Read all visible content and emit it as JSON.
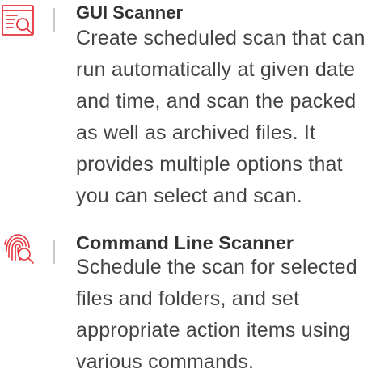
{
  "colors": {
    "accent": "#e4343b",
    "title": "#333333",
    "body": "#444444",
    "divider": "#c9c9c9"
  },
  "features": [
    {
      "icon": "window-search-icon",
      "title": "GUI Scanner",
      "description": "Create scheduled scan that can run automatically at given date and time, and scan the packed as well as archived files. It provides multiple options that you can select and scan."
    },
    {
      "icon": "fingerprint-scan-icon",
      "title": "Command Line Scanner",
      "description": "Schedule the scan for selected files and folders, and set appropriate action items using various commands."
    }
  ]
}
